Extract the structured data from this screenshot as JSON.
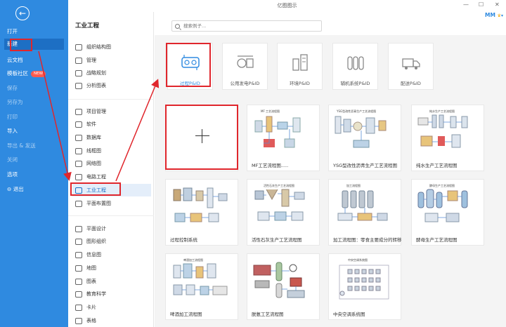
{
  "app": {
    "title": "亿图图示",
    "user": "MM"
  },
  "left_menu": [
    {
      "label": "打开",
      "dim": false
    },
    {
      "label": "新建",
      "dim": false
    },
    {
      "label": "云文档",
      "dim": false
    },
    {
      "label": "模板社区",
      "dim": false,
      "badge": "NEW"
    },
    {
      "label": "保存",
      "dim": true
    },
    {
      "label": "另存为",
      "dim": true
    },
    {
      "label": "打印",
      "dim": true
    },
    {
      "label": "导入",
      "dim": false
    },
    {
      "label": "导出 & 发送",
      "dim": true
    },
    {
      "label": "关闭",
      "dim": true
    },
    {
      "label": "选项",
      "dim": false
    },
    {
      "label": "退出",
      "dim": false
    }
  ],
  "category_panel": {
    "title": "工业工程",
    "items": [
      "组织结构图",
      "管理",
      "战略规划",
      "分析图表",
      "项目管理",
      "软件",
      "数据库",
      "线框图",
      "网络图",
      "电路工程",
      "工业工程",
      "平面布置图",
      "平面设计",
      "图形组织",
      "信息图",
      "地图",
      "图表",
      "教育科学",
      "卡片",
      "表格"
    ],
    "selected": "工业工程"
  },
  "search": {
    "placeholder": "搜索例子..."
  },
  "categories_row": [
    {
      "label": "过程P&ID",
      "icon": "process-pid-icon"
    },
    {
      "label": "公用发电P&ID",
      "icon": "power-pid-icon"
    },
    {
      "label": "环境P&ID",
      "icon": "environment-pid-icon"
    },
    {
      "label": "辅机系统P&ID",
      "icon": "auxiliary-pid-icon"
    },
    {
      "label": "配送P&ID",
      "icon": "delivery-truck-icon"
    }
  ],
  "templates": [
    {
      "label": ""
    },
    {
      "label": "MF工艺流程图.....",
      "header": "MF 工艺流程图"
    },
    {
      "label": "YSG型改性沥青生产工艺流程图",
      "header": "YSG型改性沥青生产工艺流程图"
    },
    {
      "label": "纯水生产工艺流程图",
      "header": "纯水生产工艺流程图"
    },
    {
      "label": "过程控制系统",
      "header": ""
    },
    {
      "label": "活性石灰生产工艺流程图",
      "header": "活性石灰生产工艺流程图"
    },
    {
      "label": "加工流程图：零食主要成分的转移",
      "header": "加工流程图"
    },
    {
      "label": "酵母生产工艺流程图",
      "header": "酵母生产工艺流程图"
    },
    {
      "label": "啤酒加工流程图",
      "header": "啤酒加工流程图"
    },
    {
      "label": "脱氨工艺流程图",
      "header": ""
    },
    {
      "label": "中央空调系统图",
      "header": "中央空调系统图"
    }
  ],
  "colors": {
    "accent": "#2f8ae0",
    "highlight": "#e0262c"
  }
}
